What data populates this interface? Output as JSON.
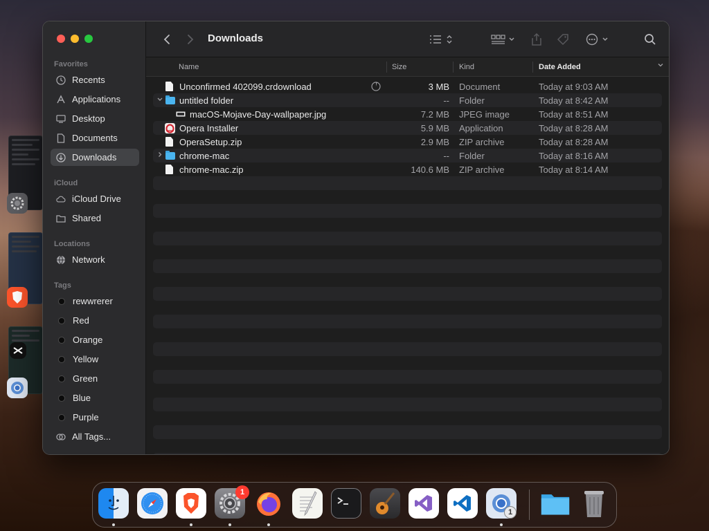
{
  "window": {
    "title": "Downloads",
    "sidebar": {
      "favorites_header": "Favorites",
      "favorites": [
        {
          "label": "Recents",
          "icon": "clock-icon"
        },
        {
          "label": "Applications",
          "icon": "applications-icon"
        },
        {
          "label": "Desktop",
          "icon": "desktop-icon"
        },
        {
          "label": "Documents",
          "icon": "document-icon"
        },
        {
          "label": "Downloads",
          "icon": "download-icon",
          "selected": true
        }
      ],
      "icloud_header": "iCloud",
      "icloud": [
        {
          "label": "iCloud Drive",
          "icon": "cloud-icon"
        },
        {
          "label": "Shared",
          "icon": "shared-folder-icon"
        }
      ],
      "locations_header": "Locations",
      "locations": [
        {
          "label": "Network",
          "icon": "globe-icon"
        }
      ],
      "tags_header": "Tags",
      "tags": [
        {
          "label": "rewwrerer"
        },
        {
          "label": "Red"
        },
        {
          "label": "Orange"
        },
        {
          "label": "Yellow"
        },
        {
          "label": "Green"
        },
        {
          "label": "Blue"
        },
        {
          "label": "Purple"
        }
      ],
      "all_tags": "All Tags..."
    },
    "columns": {
      "name": "Name",
      "size": "Size",
      "kind": "Kind",
      "date_added": "Date Added"
    },
    "files": [
      {
        "name": "Unconfirmed 402099.crdownload",
        "size": "3 MB",
        "kind": "Document",
        "date": "Today at 9:03 AM",
        "icon": "document-icon",
        "level": 0
      },
      {
        "name": "untitled folder",
        "size": "--",
        "kind": "Folder",
        "date": "Today at 8:42 AM",
        "icon": "folder-icon",
        "level": 0,
        "expanded": true
      },
      {
        "name": "macOS-Mojave-Day-wallpaper.jpg",
        "size": "7.2 MB",
        "kind": "JPEG image",
        "date": "Today at 8:51 AM",
        "icon": "image-file-icon",
        "level": 1
      },
      {
        "name": "Opera Installer",
        "size": "5.9 MB",
        "kind": "Application",
        "date": "Today at 8:28 AM",
        "icon": "opera-installer-icon",
        "level": 0
      },
      {
        "name": "OperaSetup.zip",
        "size": "2.9 MB",
        "kind": "ZIP archive",
        "date": "Today at 8:28 AM",
        "icon": "zip-icon",
        "level": 0
      },
      {
        "name": "chrome-mac",
        "size": "--",
        "kind": "Folder",
        "date": "Today at 8:16 AM",
        "icon": "folder-icon",
        "level": 0,
        "expanded": false
      },
      {
        "name": "chrome-mac.zip",
        "size": "140.6 MB",
        "kind": "ZIP archive",
        "date": "Today at 8:14 AM",
        "icon": "zip-icon",
        "level": 0
      }
    ]
  },
  "dock": {
    "apps": [
      {
        "name": "finder-icon",
        "running": true
      },
      {
        "name": "safari-icon",
        "running": false
      },
      {
        "name": "brave-icon",
        "running": true
      },
      {
        "name": "system-settings-icon",
        "running": true,
        "badge": "1"
      },
      {
        "name": "firefox-icon",
        "running": true
      },
      {
        "name": "textedit-icon",
        "running": false
      },
      {
        "name": "terminal-icon",
        "running": false
      },
      {
        "name": "garageband-icon",
        "running": false
      },
      {
        "name": "visual-studio-icon",
        "running": false
      },
      {
        "name": "vscode-icon",
        "running": false
      },
      {
        "name": "chrome-installer-icon",
        "running": true,
        "badge": "1"
      },
      {
        "name": "downloads-folder-icon",
        "running": false
      },
      {
        "name": "trash-icon",
        "running": false
      }
    ]
  },
  "colors": {
    "window_bg": "#1e1e1e",
    "sidebar_bg": "#2b2b2d",
    "selected_bg": "#424346",
    "folder_blue": "#4ab4ef",
    "close": "#ff5f57",
    "minimize": "#febc2e",
    "zoom": "#28c840"
  }
}
